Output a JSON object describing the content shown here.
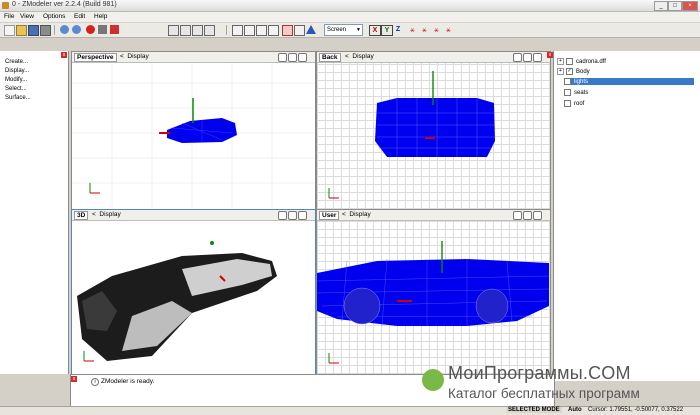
{
  "window": {
    "title": "0 - ZModeler ver 2.2.4 (Build 981)",
    "min": "_",
    "max": "□",
    "close": "×"
  },
  "menu": [
    "File",
    "View",
    "Options",
    "Edit",
    "Help"
  ],
  "toolbar": {
    "screen_mode": "Screen",
    "axis_x": "X",
    "axis_y": "Y",
    "axis_z": "Z"
  },
  "left_panel": {
    "items": [
      "Create...",
      "Display...",
      "Modify...",
      "Select...",
      "Surface..."
    ]
  },
  "viewports": [
    {
      "name": "Perspective",
      "display": "Display"
    },
    {
      "name": "Back",
      "display": "Display"
    },
    {
      "name": "3D",
      "display": "Display"
    },
    {
      "name": "User",
      "display": "Display"
    }
  ],
  "scene_tree": {
    "items": [
      "cadrona.dff",
      "Body",
      "lights",
      "seats",
      "roof"
    ],
    "selected": "lights"
  },
  "log": {
    "message": "ZModeler is ready."
  },
  "status": {
    "mode": "SELECTED MODE",
    "auto": "Auto",
    "cursor": "Cursor: 1.79551, -0.50077, 0.37522"
  },
  "watermark": {
    "line1": "МоиПрограммы.COM",
    "line2": "Каталог бесплатных программ"
  },
  "colors": {
    "accent": "#3a79c8",
    "wire": "#0000ff",
    "selected": "#3a79c8"
  }
}
